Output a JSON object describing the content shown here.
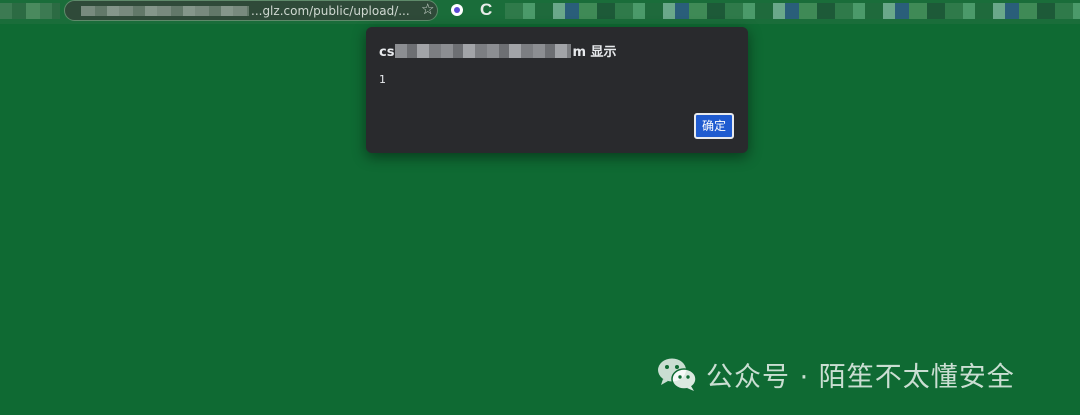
{
  "browser": {
    "address_text": "...glz.com/public/upload/...",
    "star_glyph": "☆",
    "extension_glyph": "C"
  },
  "dialog": {
    "title_prefix": "cs",
    "title_suffix": "m 显示",
    "message": "1",
    "ok_label": "确定"
  },
  "watermark": {
    "text": "公众号 · 陌笙不太懂安全",
    "icon": "wechat-icon"
  },
  "colors": {
    "page_background": "#0f6a33",
    "dialog_background": "#292a2d",
    "ok_button": "#1f5bd0"
  }
}
